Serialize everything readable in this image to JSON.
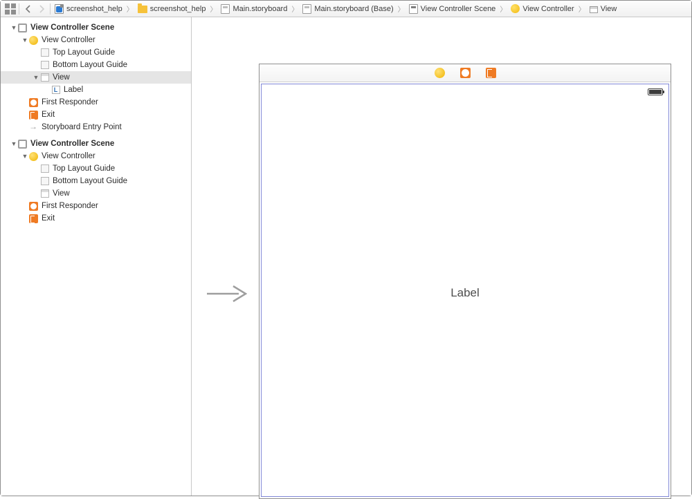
{
  "jumpbar": {
    "items": [
      {
        "label": "screenshot_help",
        "icon": "file-blue"
      },
      {
        "label": "screenshot_help",
        "icon": "folder"
      },
      {
        "label": "Main.storyboard",
        "icon": "storyboard"
      },
      {
        "label": "Main.storyboard (Base)",
        "icon": "storyboard"
      },
      {
        "label": "View Controller Scene",
        "icon": "scene"
      },
      {
        "label": "View Controller",
        "icon": "vc-circle"
      },
      {
        "label": "View",
        "icon": "view-rect"
      }
    ]
  },
  "outline": {
    "scene1": {
      "title": "View Controller Scene",
      "vc": "View Controller",
      "top_guide": "Top Layout Guide",
      "bottom_guide": "Bottom Layout Guide",
      "view": "View",
      "label": "Label",
      "first_responder": "First Responder",
      "exit": "Exit",
      "entry": "Storyboard Entry Point"
    },
    "scene2": {
      "title": "View Controller Scene",
      "vc": "View Controller",
      "top_guide": "Top Layout Guide",
      "bottom_guide": "Bottom Layout Guide",
      "view": "View",
      "first_responder": "First Responder",
      "exit": "Exit"
    }
  },
  "canvas": {
    "label_text": "Label"
  }
}
